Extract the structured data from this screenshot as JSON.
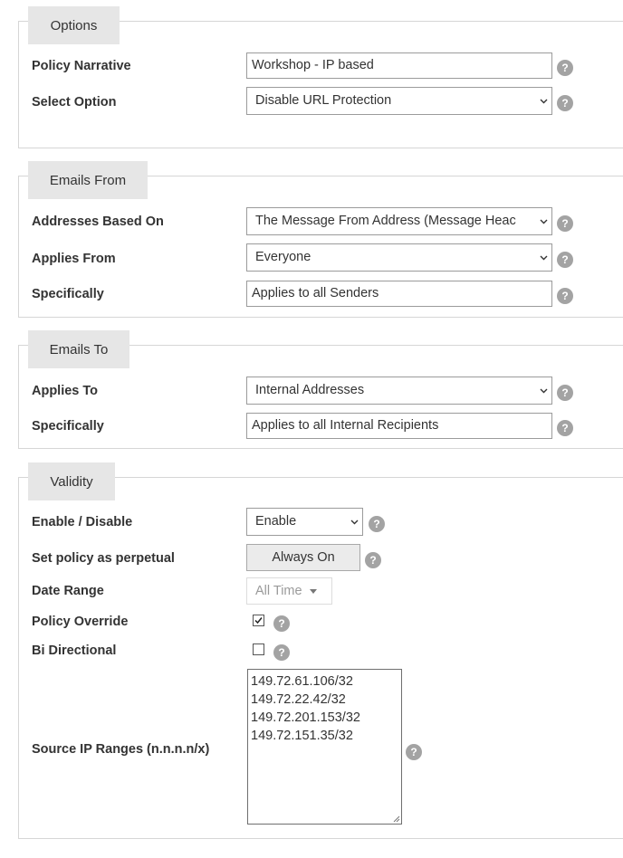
{
  "options": {
    "legend": "Options",
    "policy_narrative_label": "Policy Narrative",
    "policy_narrative_value": "Workshop - IP based",
    "select_option_label": "Select Option",
    "select_option_value": "Disable URL Protection"
  },
  "emails_from": {
    "legend": "Emails From",
    "addresses_based_on_label": "Addresses Based On",
    "addresses_based_on_value": "The Message From Address (Message Heac",
    "applies_from_label": "Applies From",
    "applies_from_value": "Everyone",
    "specifically_label": "Specifically",
    "specifically_value": "Applies to all Senders"
  },
  "emails_to": {
    "legend": "Emails To",
    "applies_to_label": "Applies To",
    "applies_to_value": "Internal Addresses",
    "specifically_label": "Specifically",
    "specifically_value": "Applies to all Internal Recipients"
  },
  "validity": {
    "legend": "Validity",
    "enable_disable_label": "Enable / Disable",
    "enable_disable_value": "Enable",
    "perpetual_label": "Set policy as perpetual",
    "perpetual_button": "Always On",
    "date_range_label": "Date Range",
    "date_range_value": "All Time",
    "policy_override_label": "Policy Override",
    "policy_override_checked": true,
    "bi_directional_label": "Bi Directional",
    "bi_directional_checked": false,
    "source_ip_label": "Source IP Ranges (n.n.n.n/x)",
    "source_ips": [
      "149.72.61.106/32",
      "149.72.22.42/32",
      "149.72.201.153/32",
      "149.72.151.35/32"
    ]
  },
  "help_glyph": "?",
  "icons": {
    "help": "question-circle-icon",
    "dropdown": "chevron-down-icon",
    "checkmark": "checkmark-icon",
    "resize": "resize-grip-icon"
  },
  "colors": {
    "legend_bg": "#e6e6e6",
    "help_icon": "#a3a3a3",
    "border": "#d6d6d6",
    "button_bg": "#ebebeb"
  }
}
